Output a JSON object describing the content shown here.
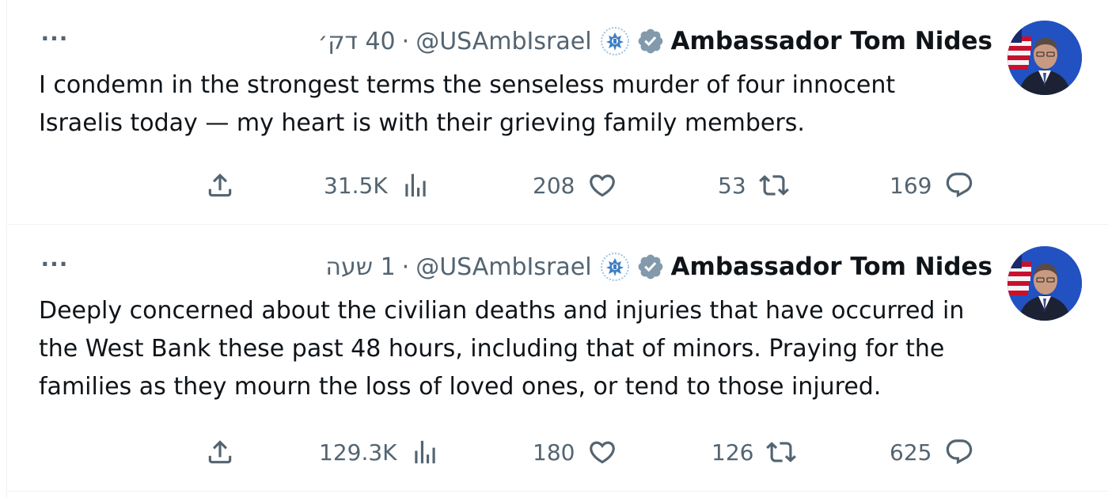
{
  "tweets": [
    {
      "author_name": "Ambassador Tom Nides",
      "handle": "@USAmbIsrael",
      "separator": "·",
      "time": "40 דק׳",
      "more": "···",
      "text_lines": [
        "I condemn in the strongest terms the senseless murder of four innocent",
        "Israelis today — my heart is with their grieving family members."
      ],
      "views": "31.5K",
      "likes": "208",
      "retweets": "53",
      "replies": "169",
      "icons": {
        "share": "share-icon",
        "views": "views-icon",
        "like": "heart-icon",
        "retweet": "retweet-icon",
        "reply": "reply-icon",
        "verified": "verified-badge-icon",
        "affiliation": "us-seal-icon"
      }
    },
    {
      "author_name": "Ambassador Tom Nides",
      "handle": "@USAmbIsrael",
      "separator": "·",
      "time": "1 שעה",
      "more": "···",
      "text_lines": [
        "Deeply concerned about the civilian deaths and injuries that have occurred in",
        "the West Bank these past 48 hours, including that of minors. Praying for the",
        "families as they mourn the loss of loved ones, or tend to those injured."
      ],
      "views": "129.3K",
      "likes": "180",
      "retweets": "126",
      "replies": "625",
      "icons": {
        "share": "share-icon",
        "views": "views-icon",
        "like": "heart-icon",
        "retweet": "retweet-icon",
        "reply": "reply-icon",
        "verified": "verified-badge-icon",
        "affiliation": "us-seal-icon"
      }
    }
  ],
  "colors": {
    "text": "#0f1419",
    "secondary": "#536471",
    "border": "#eff3f4",
    "verified_badge": "#829aab",
    "seal": "#3f7fc4"
  }
}
